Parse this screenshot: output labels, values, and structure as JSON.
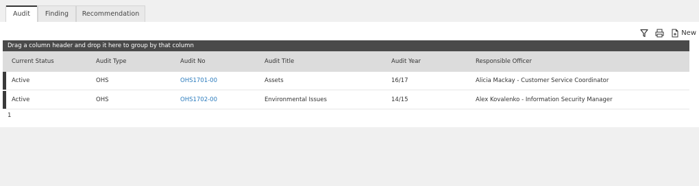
{
  "tabs": [
    {
      "label": "Audit",
      "active": true
    },
    {
      "label": "Finding",
      "active": false
    },
    {
      "label": "Recommendation",
      "active": false
    }
  ],
  "toolbar": {
    "filter_icon": "filter-icon",
    "print_icon": "print-icon",
    "new_icon": "new-document-icon",
    "new_label": "New"
  },
  "grid": {
    "group_hint": "Drag a column header and drop it here to group by that column",
    "columns": [
      "Current Status",
      "Audit Type",
      "Audit No",
      "Audit Title",
      "Audit Year",
      "Responsible Officer"
    ],
    "rows": [
      {
        "status": "Active",
        "type": "OHS",
        "no": "OHS1701-00",
        "title": "Assets",
        "year": "16/17",
        "officer": "Alicia Mackay - Customer Service Coordinator"
      },
      {
        "status": "Active",
        "type": "OHS",
        "no": "OHS1702-00",
        "title": "Environmental Issues",
        "year": "14/15",
        "officer": "Alex Kovalenko - Information Security Manager"
      }
    ],
    "page": "1"
  },
  "colors": {
    "group_bar": "#4a4a4a",
    "header_bg": "#dcdcdc",
    "link": "#2a7bbd",
    "row_marker": "#3a3a3a"
  }
}
